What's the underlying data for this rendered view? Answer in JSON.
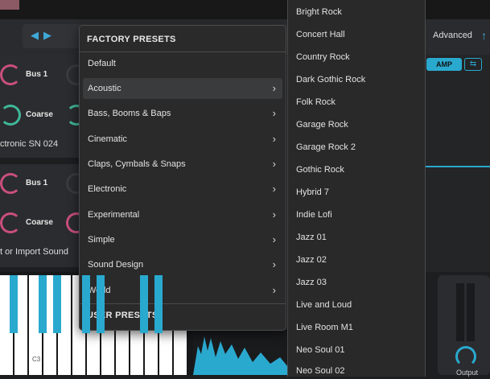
{
  "background": {
    "advanced_label": "Advanced",
    "amp_label": "AMP",
    "bus1_label": "Bus 1",
    "coarse_label": "Coarse",
    "instrument_name": "ctronic SN 024",
    "import_text": "t or Import Sound",
    "key_label": "C3",
    "output_label": "Output"
  },
  "menu": {
    "factory_title": "FACTORY PRESETS",
    "user_title": "USER PRESETS",
    "items": [
      {
        "label": "Default",
        "has_sub": false
      },
      {
        "label": "Acoustic",
        "has_sub": true
      },
      {
        "label": "Bass, Booms & Baps",
        "has_sub": true
      },
      {
        "label": "Cinematic",
        "has_sub": true
      },
      {
        "label": "Claps, Cymbals & Snaps",
        "has_sub": true
      },
      {
        "label": "Electronic",
        "has_sub": true
      },
      {
        "label": "Experimental",
        "has_sub": true
      },
      {
        "label": "Simple",
        "has_sub": true
      },
      {
        "label": "Sound Design",
        "has_sub": true
      },
      {
        "label": "World",
        "has_sub": true
      }
    ]
  },
  "submenu": {
    "items": [
      "Bright Rock",
      "Concert Hall",
      "Country Rock",
      "Dark Gothic Rock",
      "Folk Rock",
      "Garage Rock",
      "Garage Rock 2",
      "Gothic Rock",
      "Hybrid 7",
      "Indie Lofi",
      "Jazz 01",
      "Jazz 02",
      "Jazz 03",
      "Live and Loud",
      "Live Room M1",
      "Neo Soul 01",
      "Neo Soul 02"
    ]
  },
  "colors": {
    "accent": "#2aa9cf",
    "teal": "#3fb89a",
    "pink": "#c94f7c"
  }
}
